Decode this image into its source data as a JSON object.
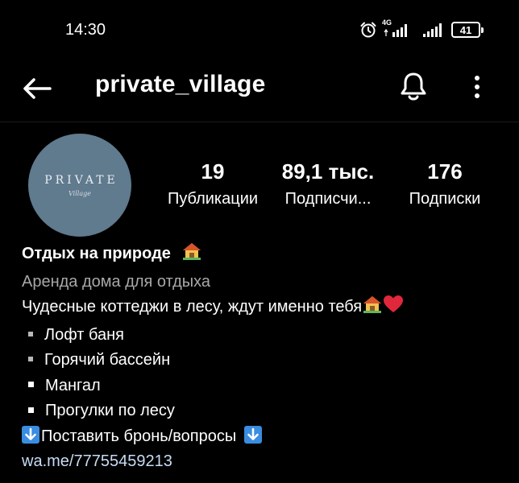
{
  "status_bar": {
    "time": "14:30",
    "network": "4G",
    "battery": "41",
    "icons": [
      "alarm-icon",
      "signal-icon",
      "signal-icon",
      "battery-icon"
    ]
  },
  "header": {
    "username": "private_village",
    "icons": [
      "back-arrow-icon",
      "bell-icon",
      "more-vertical-icon"
    ]
  },
  "avatar": {
    "title": "PRIVATE",
    "subtitle": "Village",
    "background": "#607a8e"
  },
  "stats": {
    "posts": {
      "value": "19",
      "label": "Публикации"
    },
    "followers": {
      "value": "89,1 тыс.",
      "label": "Подписчи..."
    },
    "following": {
      "value": "176",
      "label": "Подписки"
    }
  },
  "bio": {
    "name": "Отдых на природе",
    "category": "Аренда дома для отдыха",
    "description": "Чудесные коттеджи в лесу, ждут именно тебя",
    "amenities": [
      "Лофт баня",
      "Горячий бассейн",
      "Мангал",
      "Прогулки по лесу"
    ],
    "cta": "Поставить бронь/вопросы",
    "link": "wa.me/77755459213"
  },
  "colors": {
    "background": "#000000",
    "link": "#c8dcf4",
    "category": "#a8a8a8",
    "arrow_emoji": "#3a8de0",
    "heart_emoji": "#e0283a"
  }
}
